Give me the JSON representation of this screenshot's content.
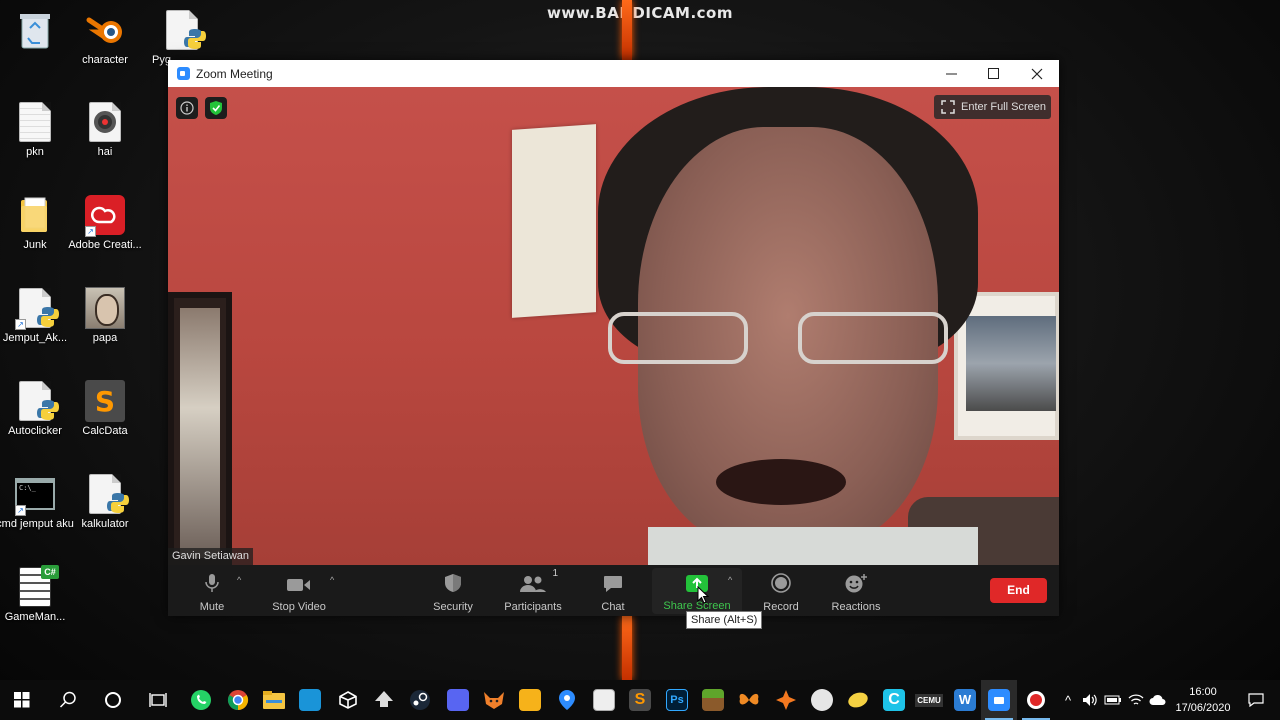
{
  "watermark": "www.BANDICAM.com",
  "desktop_icons": [
    {
      "name": "recycle-bin",
      "label": ""
    },
    {
      "name": "blender",
      "label": "character"
    },
    {
      "name": "python-file-top",
      "label": "Pyg"
    },
    {
      "name": "pkn-doc",
      "label": "pkn"
    },
    {
      "name": "hai",
      "label": "hai"
    },
    {
      "name": "junk",
      "label": "Junk"
    },
    {
      "name": "adobe-creative",
      "label": "Adobe Creati..."
    },
    {
      "name": "jemput-ak",
      "label": "Jemput_Ak..."
    },
    {
      "name": "papa",
      "label": "papa"
    },
    {
      "name": "autoclicker",
      "label": "Autoclicker"
    },
    {
      "name": "calcdata",
      "label": "CalcData"
    },
    {
      "name": "cmd-jemput",
      "label": "cmd jemput aku"
    },
    {
      "name": "kalkulator",
      "label": "kalkulator"
    },
    {
      "name": "gameman",
      "label": "GameMan..."
    }
  ],
  "zoom": {
    "title": "Zoom Meeting",
    "fullscreen_label": "Enter Full Screen",
    "participant_name": "Gavin Setiawan",
    "toolbar": {
      "mute": "Mute",
      "stop_video": "Stop Video",
      "security": "Security",
      "participants": "Participants",
      "participants_count": "1",
      "chat": "Chat",
      "share_screen": "Share Screen",
      "record": "Record",
      "reactions": "Reactions",
      "end": "End"
    },
    "tooltip": "Share (Alt+S)"
  },
  "taskbar": {
    "time": "16:00",
    "date": "17/06/2020"
  },
  "colors": {
    "zoom_blue": "#2d8cff",
    "share_green": "#23c23a",
    "end_red": "#e02828"
  }
}
